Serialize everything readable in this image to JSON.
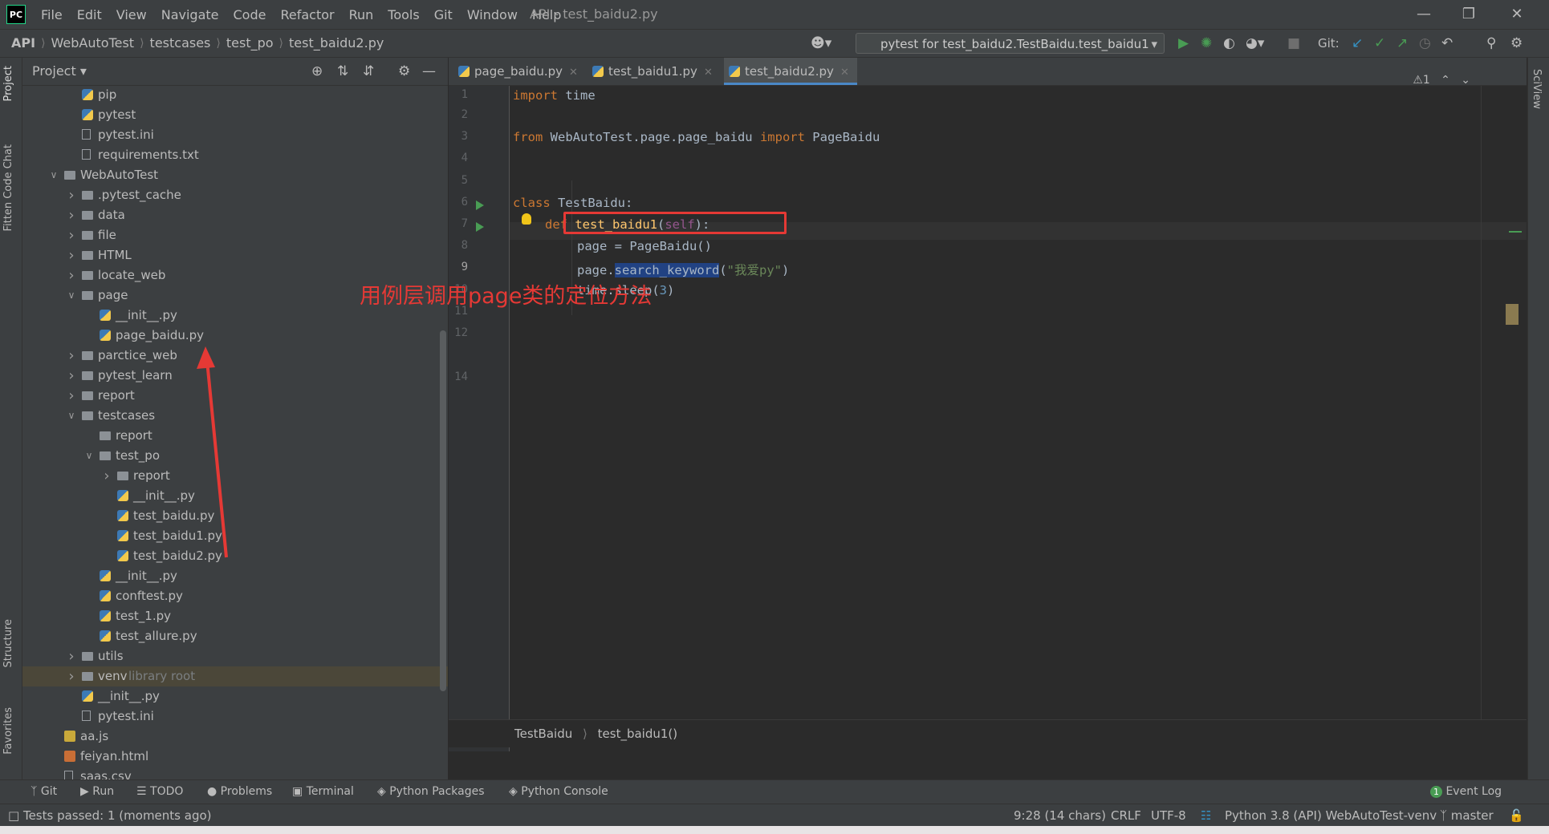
{
  "window": {
    "logo": "PC",
    "title": "API - test_baidu2.py",
    "menu": [
      "File",
      "Edit",
      "View",
      "Navigate",
      "Code",
      "Refactor",
      "Run",
      "Tools",
      "Git",
      "Window",
      "Help"
    ]
  },
  "breadcrumb": [
    "API",
    "WebAutoTest",
    "testcases",
    "test_po",
    "test_baidu2.py"
  ],
  "run_config": "pytest for test_baidu2.TestBaidu.test_baidu1",
  "git_label": "Git:",
  "left_stripe": [
    "Project",
    "Fitten Code Chat",
    "Structure",
    "Favorites"
  ],
  "right_stripe": [
    "SciView"
  ],
  "project": {
    "title": "Project",
    "tree": [
      {
        "label": "pip",
        "depth": 3,
        "type": "py"
      },
      {
        "label": "pytest",
        "depth": 3,
        "type": "py"
      },
      {
        "label": "pytest.ini",
        "depth": 3,
        "type": "txt"
      },
      {
        "label": "requirements.txt",
        "depth": 3,
        "type": "txt"
      },
      {
        "label": "WebAutoTest",
        "depth": 2,
        "type": "folder",
        "open": true
      },
      {
        "label": ".pytest_cache",
        "depth": 3,
        "type": "folder",
        "open": false
      },
      {
        "label": "data",
        "depth": 3,
        "type": "folder",
        "open": false
      },
      {
        "label": "file",
        "depth": 3,
        "type": "folder",
        "open": false
      },
      {
        "label": "HTML",
        "depth": 3,
        "type": "folder",
        "open": false
      },
      {
        "label": "locate_web",
        "depth": 3,
        "type": "folder",
        "open": false
      },
      {
        "label": "page",
        "depth": 3,
        "type": "folder",
        "open": true
      },
      {
        "label": "__init__.py",
        "depth": 4,
        "type": "py"
      },
      {
        "label": "page_baidu.py",
        "depth": 4,
        "type": "py"
      },
      {
        "label": "parctice_web",
        "depth": 3,
        "type": "folder",
        "open": false
      },
      {
        "label": "pytest_learn",
        "depth": 3,
        "type": "folder",
        "open": false
      },
      {
        "label": "report",
        "depth": 3,
        "type": "folder",
        "open": false
      },
      {
        "label": "testcases",
        "depth": 3,
        "type": "folder",
        "open": true
      },
      {
        "label": "report",
        "depth": 4,
        "type": "folder"
      },
      {
        "label": "test_po",
        "depth": 4,
        "type": "folder",
        "open": true
      },
      {
        "label": "report",
        "depth": 5,
        "type": "folder",
        "open": false
      },
      {
        "label": "__init__.py",
        "depth": 5,
        "type": "py"
      },
      {
        "label": "test_baidu.py",
        "depth": 5,
        "type": "py"
      },
      {
        "label": "test_baidu1.py",
        "depth": 5,
        "type": "py"
      },
      {
        "label": "test_baidu2.py",
        "depth": 5,
        "type": "py"
      },
      {
        "label": "__init__.py",
        "depth": 4,
        "type": "py"
      },
      {
        "label": "conftest.py",
        "depth": 4,
        "type": "py"
      },
      {
        "label": "test_1.py",
        "depth": 4,
        "type": "py"
      },
      {
        "label": "test_allure.py",
        "depth": 4,
        "type": "py"
      },
      {
        "label": "utils",
        "depth": 3,
        "type": "folder",
        "open": false
      },
      {
        "label": "venv",
        "depth": 3,
        "type": "folder",
        "open": false,
        "extra": "library root",
        "selected": true
      },
      {
        "label": "__init__.py",
        "depth": 3,
        "type": "py"
      },
      {
        "label": "pytest.ini",
        "depth": 3,
        "type": "txt"
      },
      {
        "label": "aa.js",
        "depth": 2,
        "type": "js"
      },
      {
        "label": "feiyan.html",
        "depth": 2,
        "type": "html"
      },
      {
        "label": "saas.csv",
        "depth": 2,
        "type": "txt"
      }
    ]
  },
  "tabs": [
    {
      "label": "page_baidu.py",
      "active": false
    },
    {
      "label": "test_baidu1.py",
      "active": false
    },
    {
      "label": "test_baidu2.py",
      "active": true
    }
  ],
  "editor": {
    "line_numbers": [
      "1",
      "2",
      "3",
      "4",
      "5",
      "6",
      "7",
      "8",
      "9",
      "10",
      "11",
      "12",
      "",
      "14"
    ],
    "warnings": "1",
    "code": {
      "l1_kw": "import",
      "l1_rest": " time",
      "l3_kw1": "from",
      "l3_mid": " WebAutoTest.page.page_baidu ",
      "l3_kw2": "import",
      "l3_rest": " PageBaidu",
      "l6_kw": "class",
      "l6_rest": " TestBaidu:",
      "l7_kw": "def",
      "l7_fn": "test_baidu1",
      "l7_open": "(",
      "l7_self": "self",
      "l7_close": "):",
      "l8": "page = PageBaidu()",
      "l9_obj": "page.",
      "l9_sel": "search_keyword",
      "l9_open": "(",
      "l9_str": "\"我爱py\"",
      "l9_close": ")",
      "l10_obj": "time.sleep(",
      "l10_num": "3",
      "l10_close": ")"
    },
    "annotation": "用例层调用page类的定位方法",
    "breadcrumb": [
      "TestBaidu",
      "test_baidu1()"
    ]
  },
  "bottom_tabs": [
    "Git",
    "Run",
    "TODO",
    "Problems",
    "Terminal",
    "Python Packages",
    "Python Console"
  ],
  "event_log": "Event Log",
  "event_count": "1",
  "status": {
    "message": "Tests passed: 1 (moments ago)",
    "position": "9:28 (14 chars)",
    "line_sep": "CRLF",
    "encoding": "UTF-8",
    "interpreter": "Python 3.8 (API) WebAutoTest-venv",
    "branch": "master"
  }
}
